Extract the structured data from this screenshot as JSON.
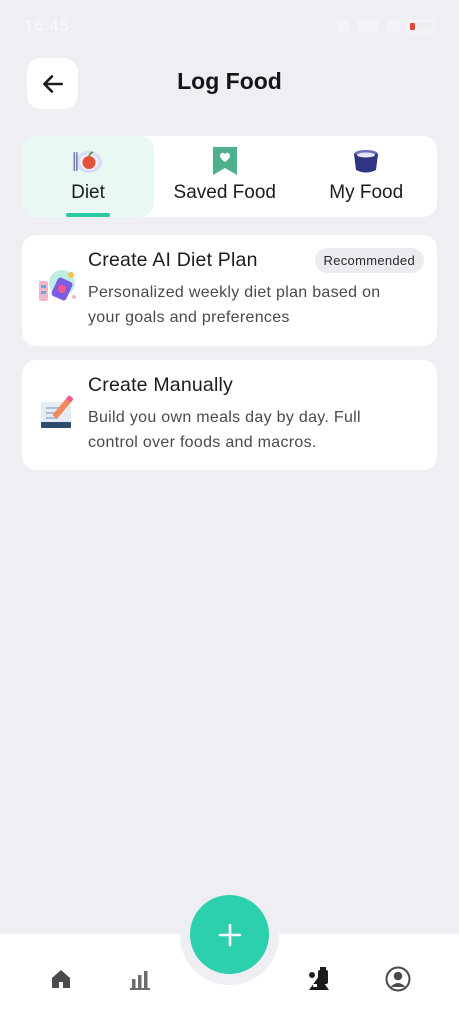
{
  "status_bar": {
    "time": "16:45"
  },
  "header": {
    "title": "Log Food",
    "back_icon": "arrow-left-icon"
  },
  "tabs": [
    {
      "label": "Diet",
      "icon": "plate-apple-icon",
      "active": true
    },
    {
      "label": "Saved Food",
      "icon": "bookmark-heart-icon",
      "active": false
    },
    {
      "label": "My Food",
      "icon": "food-bowl-icon",
      "active": false
    }
  ],
  "cards": {
    "ai_plan": {
      "title": "Create AI Diet Plan",
      "badge": "Recommended",
      "desc_line1": "Personalized weekly diet plan based on",
      "desc_line2": "your goals and preferences",
      "icon": "ai-plan-icon"
    },
    "manual": {
      "title": "Create Manually",
      "desc_line1": "Build you own meals day by day. Full",
      "desc_line2": "control over foods and macros.",
      "icon": "notebook-pencil-icon"
    }
  },
  "bottom_nav": {
    "items": [
      "home-icon",
      "stats-icon",
      "add-icon",
      "diet-icon",
      "profile-icon"
    ],
    "accent": "#2dd0ad"
  },
  "colors": {
    "accent": "#2bc8a5",
    "background": "#efeff3",
    "card": "#ffffff"
  }
}
